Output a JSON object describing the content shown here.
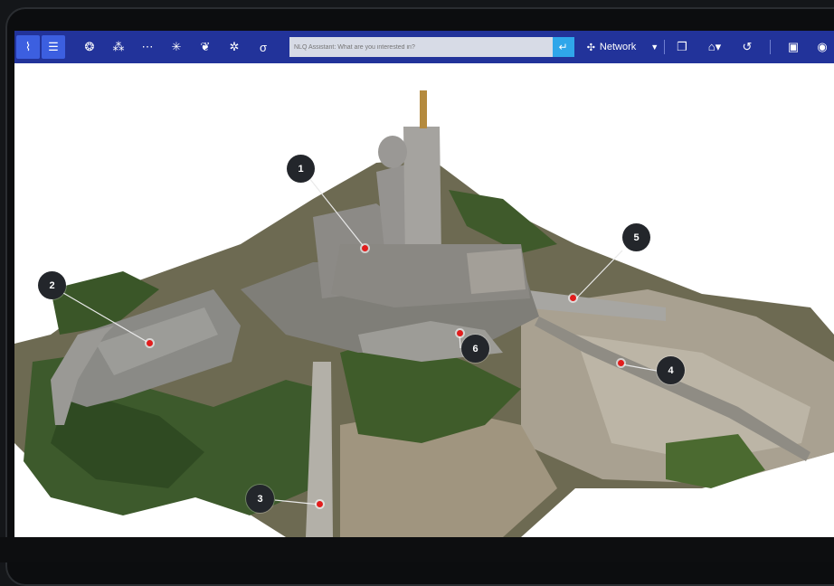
{
  "toolbar": {
    "left_buttons": [
      {
        "icon": "chart-icon",
        "glyph": "⌇"
      },
      {
        "icon": "list-icon",
        "glyph": "☰"
      }
    ],
    "tools": [
      {
        "icon": "brain-icon",
        "glyph": "❂"
      },
      {
        "icon": "network-nodes-icon",
        "glyph": "⁂"
      },
      {
        "icon": "share-nodes-icon",
        "glyph": "⋯"
      },
      {
        "icon": "graph-icon",
        "glyph": "✳"
      },
      {
        "icon": "lightbulb-icon",
        "glyph": "❦"
      },
      {
        "icon": "satellite-icon",
        "glyph": "✲"
      },
      {
        "icon": "sigma-icon",
        "glyph": "σ"
      }
    ],
    "search": {
      "placeholder": "NLQ Assistant: What are you interested in?",
      "submit_glyph": "↵"
    },
    "network_label": "Network",
    "network_glyph": "✣",
    "dropdown_glyph": "▼",
    "right_buttons": [
      {
        "icon": "layers-icon",
        "glyph": "❐"
      },
      {
        "icon": "settings-dropdown-icon",
        "glyph": "⌂▾"
      },
      {
        "icon": "history-icon",
        "glyph": "↺"
      },
      {
        "icon": "camera-icon",
        "glyph": "▣"
      },
      {
        "icon": "eye-icon",
        "glyph": "◉"
      }
    ]
  },
  "map": {
    "markers": [
      {
        "label": "1"
      },
      {
        "label": "2"
      },
      {
        "label": "3"
      },
      {
        "label": "4"
      },
      {
        "label": "5"
      },
      {
        "label": "6"
      }
    ]
  },
  "colors": {
    "toolbar_bg": "#22339a",
    "toolbar_active": "#3c5fe0",
    "search_submit": "#2fa6ea",
    "marker_bg": "#23262b",
    "pin": "#e11d1d"
  }
}
